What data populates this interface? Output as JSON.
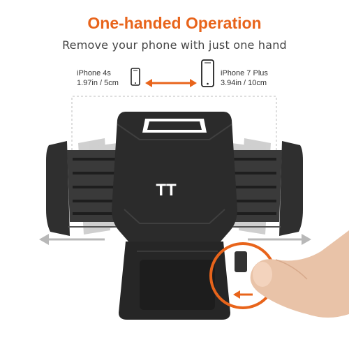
{
  "headline": "One-handed Operation",
  "subheadline": "Remove your phone with just one hand",
  "small_phone": {
    "model": "iPhone 4s",
    "size": "1.97in / 5cm"
  },
  "large_phone": {
    "model": "iPhone 7 Plus",
    "size": "3.94in / 10cm"
  },
  "brand_logo": "TT",
  "colors": {
    "accent": "#e8641b",
    "mount_body": "#2b2b2b",
    "arrow_gray": "#b8b8b8"
  }
}
